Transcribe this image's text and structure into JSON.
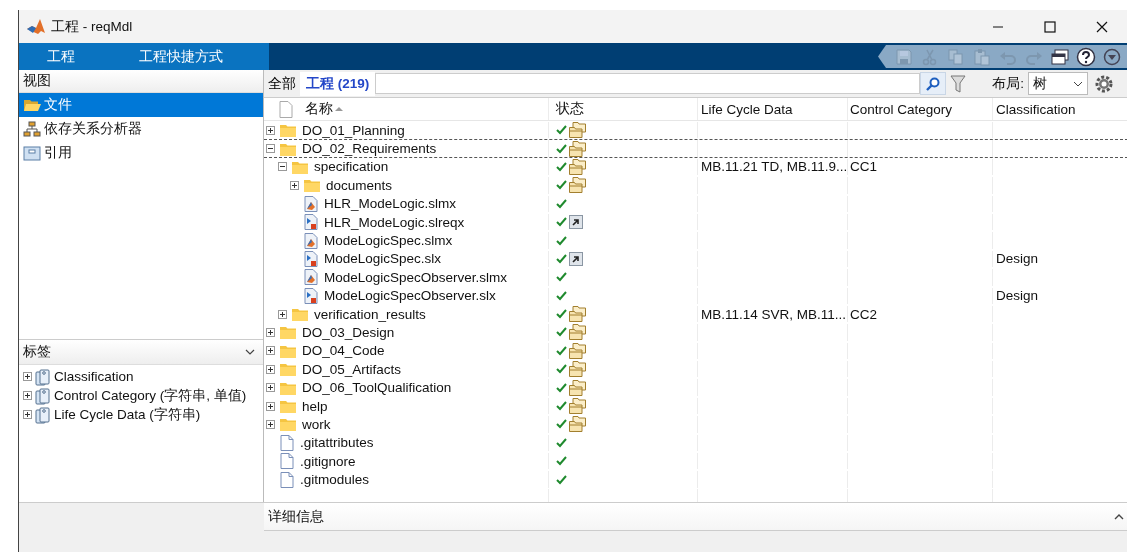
{
  "window": {
    "title": "工程 - reqMdl"
  },
  "ribbon_tabs": [
    "工程",
    "工程快捷方式"
  ],
  "quick_access": [
    {
      "kind": "save",
      "disabled": true
    },
    {
      "kind": "cut",
      "disabled": true
    },
    {
      "kind": "copy",
      "disabled": true
    },
    {
      "kind": "paste",
      "disabled": true
    },
    {
      "kind": "undo",
      "disabled": true
    },
    {
      "kind": "redo",
      "disabled": true
    },
    {
      "kind": "windows",
      "disabled": false
    },
    {
      "kind": "help",
      "disabled": false
    },
    {
      "kind": "more",
      "disabled": false
    }
  ],
  "views": {
    "header": "视图",
    "items": [
      {
        "label": "文件",
        "selected": true
      },
      {
        "label": "依存关系分析器",
        "selected": false
      },
      {
        "label": "引用",
        "selected": false
      }
    ]
  },
  "labels_panel": {
    "header": "标签",
    "items": [
      {
        "label": "Classification",
        "expanded": false
      },
      {
        "label": "Control Category (字符串, 单值)",
        "expanded": false
      },
      {
        "label": "Life Cycle Data (字符串)",
        "expanded": false
      }
    ]
  },
  "scope_tabs": [
    {
      "label": "全部",
      "selected": false
    },
    {
      "label": "工程 (219)",
      "selected": true
    }
  ],
  "layout": {
    "label": "布局:",
    "value": "树"
  },
  "table": {
    "columns": [
      {
        "label": "名称",
        "sorted": true
      },
      {
        "label": "状态",
        "sorted": false
      },
      {
        "label": "Life Cycle Data",
        "sorted": false
      },
      {
        "label": "Control Category",
        "sorted": false
      },
      {
        "label": "Classification",
        "sorted": false
      }
    ],
    "rows": [
      {
        "name": "DO_01_Planning",
        "kind": "folder",
        "expanded": false,
        "selected": false,
        "status": {
          "kind": "project"
        }
      },
      {
        "name": "DO_02_Requirements",
        "kind": "folder",
        "expanded": true,
        "selected": true,
        "status": {
          "kind": "project"
        },
        "children": [
          {
            "name": "specification",
            "kind": "folder",
            "expanded": true,
            "selected": false,
            "status": {
              "kind": "project"
            },
            "life_cycle_data": "MB.11.21 TD, MB.11.9...",
            "control_category": "CC1",
            "children": [
              {
                "name": "documents",
                "kind": "folder",
                "expanded": false,
                "selected": false,
                "status": {
                  "kind": "project"
                }
              },
              {
                "name": "HLR_ModeLogic.slmx",
                "kind": "slmx",
                "selected": false
              },
              {
                "name": "HLR_ModeLogic.slreqx",
                "kind": "slx",
                "selected": false,
                "status": {
                  "kind": "shortcut"
                }
              },
              {
                "name": "ModeLogicSpec.slmx",
                "kind": "slmx",
                "selected": false
              },
              {
                "name": "ModeLogicSpec.slx",
                "kind": "slx",
                "selected": false,
                "status": {
                  "kind": "shortcut"
                },
                "classification": "Design"
              },
              {
                "name": "ModeLogicSpecObserver.slmx",
                "kind": "slmx",
                "selected": false
              },
              {
                "name": "ModeLogicSpecObserver.slx",
                "kind": "slx",
                "selected": false,
                "classification": "Design"
              }
            ]
          },
          {
            "name": "verification_results",
            "kind": "folder",
            "expanded": false,
            "selected": false,
            "status": {
              "kind": "project"
            },
            "life_cycle_data": "MB.11.14 SVR, MB.11....",
            "control_category": "CC2"
          }
        ]
      },
      {
        "name": "DO_03_Design",
        "kind": "folder",
        "expanded": false,
        "selected": false,
        "status": {
          "kind": "project"
        }
      },
      {
        "name": "DO_04_Code",
        "kind": "folder",
        "expanded": false,
        "selected": false,
        "status": {
          "kind": "project"
        }
      },
      {
        "name": "DO_05_Artifacts",
        "kind": "folder",
        "expanded": false,
        "selected": false,
        "status": {
          "kind": "project"
        }
      },
      {
        "name": "DO_06_ToolQualification",
        "kind": "folder",
        "expanded": false,
        "selected": false,
        "status": {
          "kind": "project"
        }
      },
      {
        "name": "help",
        "kind": "folder",
        "expanded": false,
        "selected": false,
        "status": {
          "kind": "project"
        }
      },
      {
        "name": "work",
        "kind": "folder",
        "expanded": false,
        "selected": false,
        "status": {
          "kind": "project"
        }
      },
      {
        "name": ".gitattributes",
        "kind": "file",
        "selected": false
      },
      {
        "name": ".gitignore",
        "kind": "file",
        "selected": false
      },
      {
        "name": ".gitmodules",
        "kind": "file",
        "selected": false
      }
    ]
  },
  "details": {
    "label": "详细信息"
  }
}
